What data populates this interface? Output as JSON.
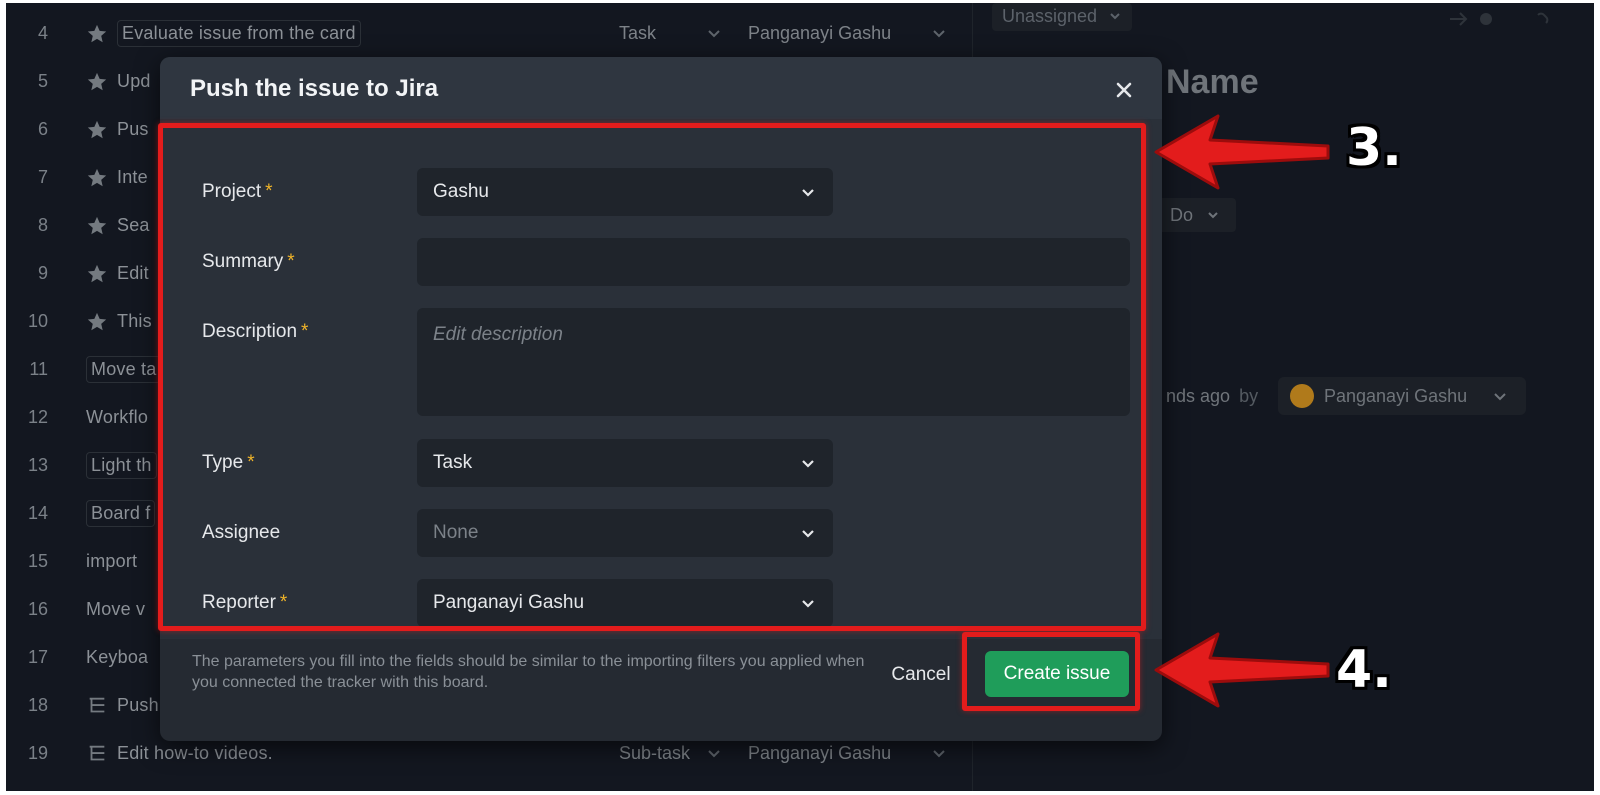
{
  "background_list": {
    "rows": [
      {
        "num": "4",
        "icon": "star-icon",
        "title": "Evaluate issue from the card",
        "boxed": true,
        "type": "Task",
        "assignee": "Panganayi Gashu"
      },
      {
        "num": "5",
        "icon": "star-icon",
        "title": "Upd",
        "boxed": false,
        "type": "",
        "assignee": ""
      },
      {
        "num": "6",
        "icon": "star-icon",
        "title": "Pus",
        "boxed": false,
        "type": "",
        "assignee": ""
      },
      {
        "num": "7",
        "icon": "star-icon",
        "title": "Inte",
        "boxed": false,
        "type": "",
        "assignee": ""
      },
      {
        "num": "8",
        "icon": "star-icon",
        "title": "Sea",
        "boxed": false,
        "type": "",
        "assignee": ""
      },
      {
        "num": "9",
        "icon": "star-icon",
        "title": "Edit",
        "boxed": false,
        "type": "",
        "assignee": ""
      },
      {
        "num": "10",
        "icon": "star-icon",
        "title": "This",
        "boxed": false,
        "type": "",
        "assignee": ""
      },
      {
        "num": "11",
        "icon": "",
        "title": "Move ta",
        "boxed": true,
        "type": "",
        "assignee": ""
      },
      {
        "num": "12",
        "icon": "",
        "title": "Workflo",
        "boxed": false,
        "type": "",
        "assignee": ""
      },
      {
        "num": "13",
        "icon": "",
        "title": "Light th",
        "boxed": true,
        "type": "",
        "assignee": ""
      },
      {
        "num": "14",
        "icon": "",
        "title": "Board f",
        "boxed": true,
        "type": "",
        "assignee": ""
      },
      {
        "num": "15",
        "icon": "",
        "title": "import",
        "boxed": false,
        "type": "",
        "assignee": ""
      },
      {
        "num": "16",
        "icon": "",
        "title": "Move v",
        "boxed": false,
        "type": "",
        "assignee": ""
      },
      {
        "num": "17",
        "icon": "",
        "title": "Keyboa",
        "boxed": false,
        "type": "",
        "assignee": ""
      },
      {
        "num": "18",
        "icon": "subtask-icon",
        "title": "Push",
        "boxed": false,
        "type": "",
        "assignee": ""
      },
      {
        "num": "19",
        "icon": "subtask-icon",
        "title": "Edit how-to videos.",
        "boxed": false,
        "type": "Sub-task",
        "assignee": "Panganayi Gashu"
      }
    ]
  },
  "right_panel": {
    "assignee_select": "Unassigned",
    "heading": "Name",
    "status": "Do",
    "time_ago": "nds ago",
    "by": "by",
    "person": "Panganayi Gashu"
  },
  "modal": {
    "title": "Push the issue to Jira",
    "fields": {
      "project": {
        "label": "Project",
        "required": "*",
        "value": "Gashu"
      },
      "summary": {
        "label": "Summary",
        "required": "*",
        "value": ""
      },
      "description": {
        "label": "Description",
        "required": "*",
        "placeholder": "Edit description"
      },
      "type": {
        "label": "Type",
        "required": "*",
        "value": "Task"
      },
      "assignee": {
        "label": "Assignee",
        "value": "None"
      },
      "reporter": {
        "label": "Reporter",
        "required": "*",
        "value": "Panganayi Gashu"
      }
    },
    "footer_note": "The parameters you fill into the fields should be similar to the importing filters you applied when you connected the tracker with this board.",
    "cancel_label": "Cancel",
    "create_label": "Create issue"
  },
  "annotations": {
    "step3": "3.",
    "step4": "4."
  },
  "colors": {
    "accent_green": "#1f9d5a",
    "required_star": "#f0b429",
    "highlight_red": "#e31c1c"
  }
}
